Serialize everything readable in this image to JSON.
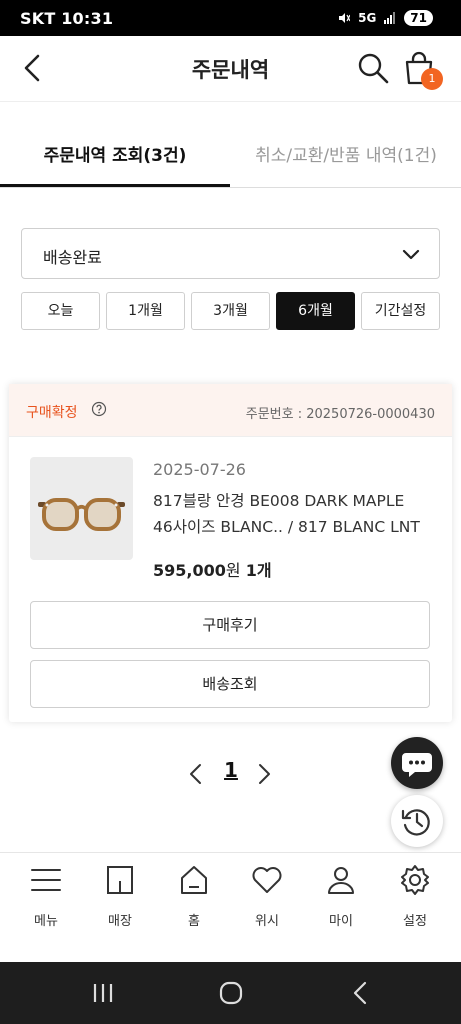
{
  "status_bar": {
    "carrier": "SKT",
    "time": "10:31",
    "network": "5G",
    "battery": "71"
  },
  "header": {
    "title": "주문내역",
    "cart_count": "1"
  },
  "tabs": {
    "active": "주문내역 조회(3건)",
    "inactive": "취소/교환/반품 내역(1건)"
  },
  "filter": {
    "selected": "배송완료"
  },
  "periods": [
    "오늘",
    "1개월",
    "3개월",
    "6개월",
    "기간설정"
  ],
  "active_period": "6개월",
  "order": {
    "status": "구매확정",
    "number_label": "주문번호 : ",
    "number": "20250726-0000430",
    "date": "2025-07-26",
    "product_line1": "817블랑 안경 BE008 DARK MAPLE",
    "product_line2": "46사이즈 BLANC.. / 817 BLANC LNT",
    "price": "595,000",
    "price_unit": "원",
    "qty": "1개",
    "review_button": "구매후기",
    "tracking_button": "배송조회"
  },
  "pager": {
    "current": "1"
  },
  "bottom_nav": [
    {
      "label": "메뉴",
      "icon": "menu-icon"
    },
    {
      "label": "매장",
      "icon": "store-icon"
    },
    {
      "label": "홈",
      "icon": "home-icon"
    },
    {
      "label": "위시",
      "icon": "heart-icon"
    },
    {
      "label": "마이",
      "icon": "person-icon"
    },
    {
      "label": "설정",
      "icon": "gear-icon"
    }
  ],
  "colors": {
    "accent": "#e8531e",
    "badge": "#f26522",
    "order_head_bg": "#fdf3ef",
    "active_period_bg": "#111111"
  }
}
